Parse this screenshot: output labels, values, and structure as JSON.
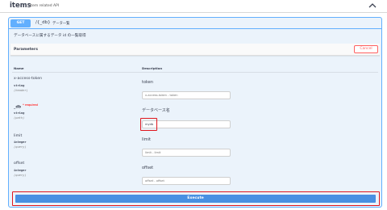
{
  "header": {
    "title": "items",
    "description": "Item related API"
  },
  "operation": {
    "method": "GET",
    "path": "/{_db}",
    "summary": "データ一覧",
    "description": "データベースに属するデータ id の一覧取得"
  },
  "parameters_section": {
    "title": "Parameters",
    "cancel_label": "Cancel",
    "col_name": "Name",
    "col_description": "Description"
  },
  "params": [
    {
      "name": "x-access-token",
      "required": "",
      "type": "string",
      "location": "(header)",
      "description": "token",
      "placeholder": "x-access-token - token",
      "value": ""
    },
    {
      "name": "_db",
      "required": "* required",
      "type": "string",
      "location": "(path)",
      "description": "データベース名",
      "placeholder": "",
      "value": "mydb"
    },
    {
      "name": "limit",
      "required": "",
      "type": "integer",
      "location": "(query)",
      "description": "limit",
      "placeholder": "limit - limit",
      "value": ""
    },
    {
      "name": "offset",
      "required": "",
      "type": "integer",
      "location": "(query)",
      "description": "offset",
      "placeholder": "offset - offset",
      "value": ""
    }
  ],
  "execute_label": "Execute",
  "colors": {
    "get_blue": "#61affe",
    "execute_blue": "#4990e2",
    "highlight_red": "#e0161d",
    "cancel_red": "#ff6060",
    "panel_bg": "#ebf3fb"
  },
  "icons": {
    "collapse": "chevron-up-icon"
  }
}
